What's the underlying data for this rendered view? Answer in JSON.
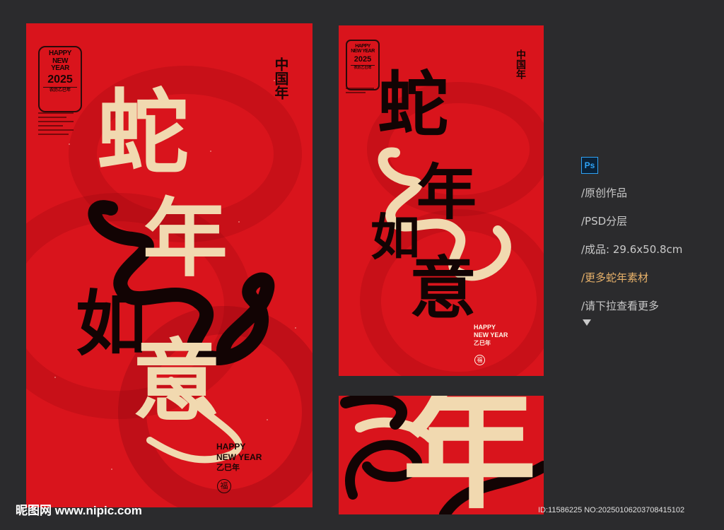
{
  "poster_main": {
    "badge": {
      "line1": "HAPPY",
      "line2": "NEW YEAR",
      "year": "2025",
      "sub": "农历乙巳年"
    },
    "seal": "中国年",
    "calligraphy": [
      "蛇",
      "年",
      "如",
      "意"
    ],
    "greeting_lines": [
      "HAPPY",
      "NEW YEAR"
    ],
    "year_name": "乙巳年",
    "fu": "福"
  },
  "poster_small": {
    "badge": {
      "line1": "HAPPY",
      "line2": "NEW YEAR",
      "year": "2025",
      "sub": "农历乙巳年"
    },
    "seal": "中国年",
    "calligraphy": [
      "蛇",
      "年",
      "如",
      "意"
    ],
    "greeting_lines": [
      "HAPPY",
      "NEW YEAR"
    ],
    "year_name": "乙巳年",
    "fu": "福"
  },
  "detail_crop": {
    "character": "年"
  },
  "sidebar": {
    "app_icon_label": "Ps",
    "items": [
      "/原创作品",
      "/PSD分层",
      "/成品: 29.6x50.8cm",
      "/更多蛇年素材",
      "/请下拉查看更多"
    ],
    "highlight_index": 3
  },
  "footer": {
    "logo": "昵图网 www.nipic.com",
    "id_text": "ID:11586225 NO:20250106203708415102"
  },
  "colors": {
    "background": "#2b2b2d",
    "poster_red": "#d9141c",
    "cream": "#f1d9b0",
    "ink": "#120404",
    "accent": "#e8b26a",
    "ps_blue": "#2fa3f6"
  }
}
